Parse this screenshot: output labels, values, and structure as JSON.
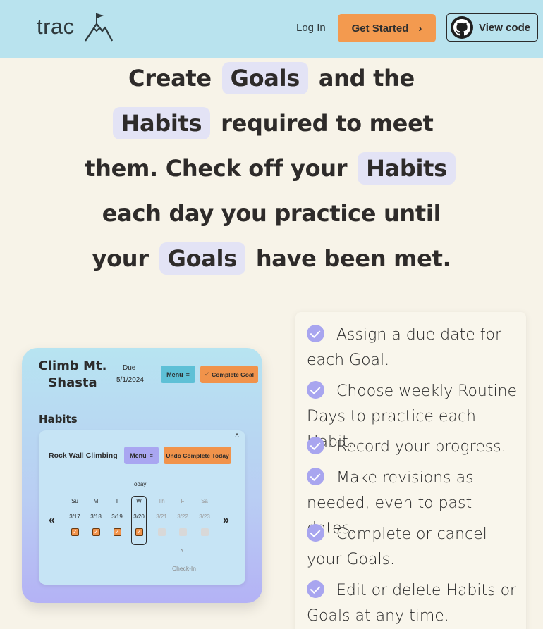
{
  "header": {
    "brand": "trac",
    "login_label": "Log In",
    "get_started_label": "Get Started",
    "get_started_chevron": "›",
    "view_code_label": "View code"
  },
  "hero": {
    "line1": {
      "a": "Create",
      "hl": "Goals",
      "b": "and the"
    },
    "line2": {
      "hl": "Habits",
      "b": "required to meet"
    },
    "line3": {
      "a": "them. Check off your",
      "hl": "Habits"
    },
    "line4": {
      "a": "each day you practice until"
    },
    "line5": {
      "a": "your",
      "hl": "Goals",
      "b": "have been met."
    }
  },
  "demo": {
    "goal_title": "Climb Mt. Shasta",
    "due_label": "Due",
    "due_date": "5/1/2024",
    "menu_label": "Menu",
    "menu_icon": "≡",
    "complete_goal_label": "Complete Goal",
    "complete_icon": "✓",
    "habits_heading": "Habits",
    "habit": {
      "collapse_icon": "˄",
      "name": "Rock Wall Climbing",
      "menu_label": "Menu",
      "undo_label": "Undo Complete Today",
      "today_label": "Today",
      "prev_arrow": "«",
      "next_arrow": "»",
      "days": [
        {
          "name": "Su",
          "date": "3/17",
          "checked": true
        },
        {
          "name": "M",
          "date": "3/18",
          "checked": true
        },
        {
          "name": "T",
          "date": "3/19",
          "checked": true
        },
        {
          "name": "W",
          "date": "3/20",
          "checked": true
        },
        {
          "name": "Th",
          "date": "3/21",
          "checked": false
        },
        {
          "name": "F",
          "date": "3/22",
          "checked": false
        },
        {
          "name": "Sa",
          "date": "3/23",
          "checked": false
        }
      ],
      "checkin_caret": "˄",
      "checkin_label": "Check-In"
    }
  },
  "features": [
    "Assign a due date for each Goal.",
    "Choose weekly Routine Days to practice each Habit.",
    "Record your progress.",
    "Make revisions as needed, even to past dates.",
    "Complete or cancel your Goals.",
    "Edit or delete Habits or Goals at any time."
  ],
  "colors": {
    "header_bg": "#b9e3ee",
    "page_bg": "#f7f3e8",
    "accent_orange": "#f39a4f",
    "highlight": "#e3e3f5",
    "check_purple": "#a8a5ef"
  }
}
